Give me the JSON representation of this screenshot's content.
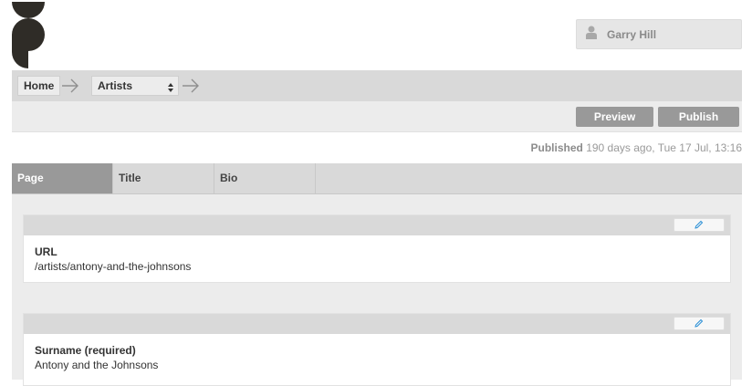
{
  "user": {
    "name": "Garry Hill",
    "icon": "user-icon"
  },
  "breadcrumb": {
    "home": "Home",
    "section": "Artists"
  },
  "actions": {
    "preview": "Preview",
    "publish": "Publish"
  },
  "status": {
    "label": "Published",
    "detail": " 190 days ago, Tue 17 Jul, 13:16"
  },
  "tabs": [
    {
      "label": "Page",
      "active": true
    },
    {
      "label": "Title",
      "active": false
    },
    {
      "label": "Bio",
      "active": false
    }
  ],
  "fields": [
    {
      "label": "URL",
      "value": "/artists/antony-and-the-johnsons"
    },
    {
      "label": "Surname (required)",
      "value": "Antony and the Johnsons"
    }
  ],
  "colors": {
    "accent": "#999999",
    "bar": "#d9d9d9",
    "panel": "#ececec",
    "edit_icon": "#2a8fd6"
  }
}
